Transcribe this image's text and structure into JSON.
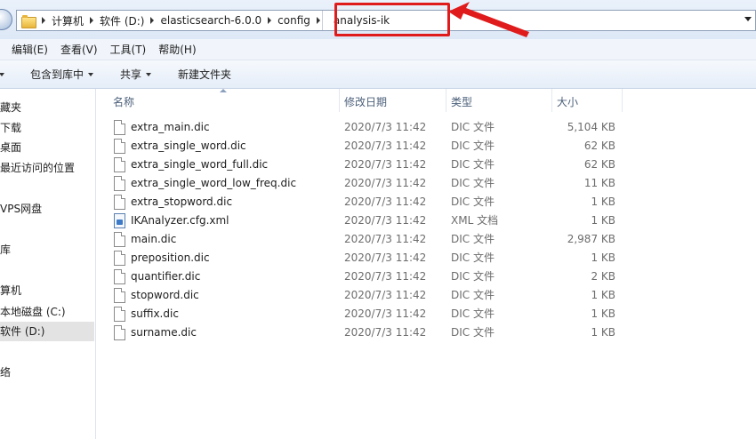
{
  "address": {
    "crumbs": [
      "计算机",
      "软件 (D:)",
      "elasticsearch-6.0.0",
      "config"
    ],
    "current": "analysis-ik"
  },
  "menu": [
    "编辑(E)",
    "查看(V)",
    "工具(T)",
    "帮助(H)"
  ],
  "toolbar": {
    "include_library": "包含到库中",
    "share": "共享",
    "new_folder": "新建文件夹"
  },
  "nav": [
    "藏夹",
    "下载",
    "桌面",
    "最近访问的位置",
    "VPS网盘",
    "库",
    "算机",
    "本地磁盘 (C:)",
    "软件 (D:)",
    "络"
  ],
  "columns": {
    "name": "名称",
    "date": "修改日期",
    "type": "类型",
    "size": "大小"
  },
  "files": [
    {
      "name": "extra_main.dic",
      "date": "2020/7/3 11:42",
      "type": "DIC 文件",
      "size": "5,104 KB",
      "icon": "file-icon"
    },
    {
      "name": "extra_single_word.dic",
      "date": "2020/7/3 11:42",
      "type": "DIC 文件",
      "size": "62 KB",
      "icon": "file-icon"
    },
    {
      "name": "extra_single_word_full.dic",
      "date": "2020/7/3 11:42",
      "type": "DIC 文件",
      "size": "62 KB",
      "icon": "file-icon"
    },
    {
      "name": "extra_single_word_low_freq.dic",
      "date": "2020/7/3 11:42",
      "type": "DIC 文件",
      "size": "11 KB",
      "icon": "file-icon"
    },
    {
      "name": "extra_stopword.dic",
      "date": "2020/7/3 11:42",
      "type": "DIC 文件",
      "size": "1 KB",
      "icon": "file-icon"
    },
    {
      "name": "IKAnalyzer.cfg.xml",
      "date": "2020/7/3 11:42",
      "type": "XML 文档",
      "size": "1 KB",
      "icon": "xml-file-icon"
    },
    {
      "name": "main.dic",
      "date": "2020/7/3 11:42",
      "type": "DIC 文件",
      "size": "2,987 KB",
      "icon": "file-icon"
    },
    {
      "name": "preposition.dic",
      "date": "2020/7/3 11:42",
      "type": "DIC 文件",
      "size": "1 KB",
      "icon": "file-icon"
    },
    {
      "name": "quantifier.dic",
      "date": "2020/7/3 11:42",
      "type": "DIC 文件",
      "size": "2 KB",
      "icon": "file-icon"
    },
    {
      "name": "stopword.dic",
      "date": "2020/7/3 11:42",
      "type": "DIC 文件",
      "size": "1 KB",
      "icon": "file-icon"
    },
    {
      "name": "suffix.dic",
      "date": "2020/7/3 11:42",
      "type": "DIC 文件",
      "size": "1 KB",
      "icon": "file-icon"
    },
    {
      "name": "surname.dic",
      "date": "2020/7/3 11:42",
      "type": "DIC 文件",
      "size": "1 KB",
      "icon": "file-icon"
    }
  ],
  "colors": {
    "highlight": "#e01b1b",
    "selection": "#e3e3e3"
  }
}
